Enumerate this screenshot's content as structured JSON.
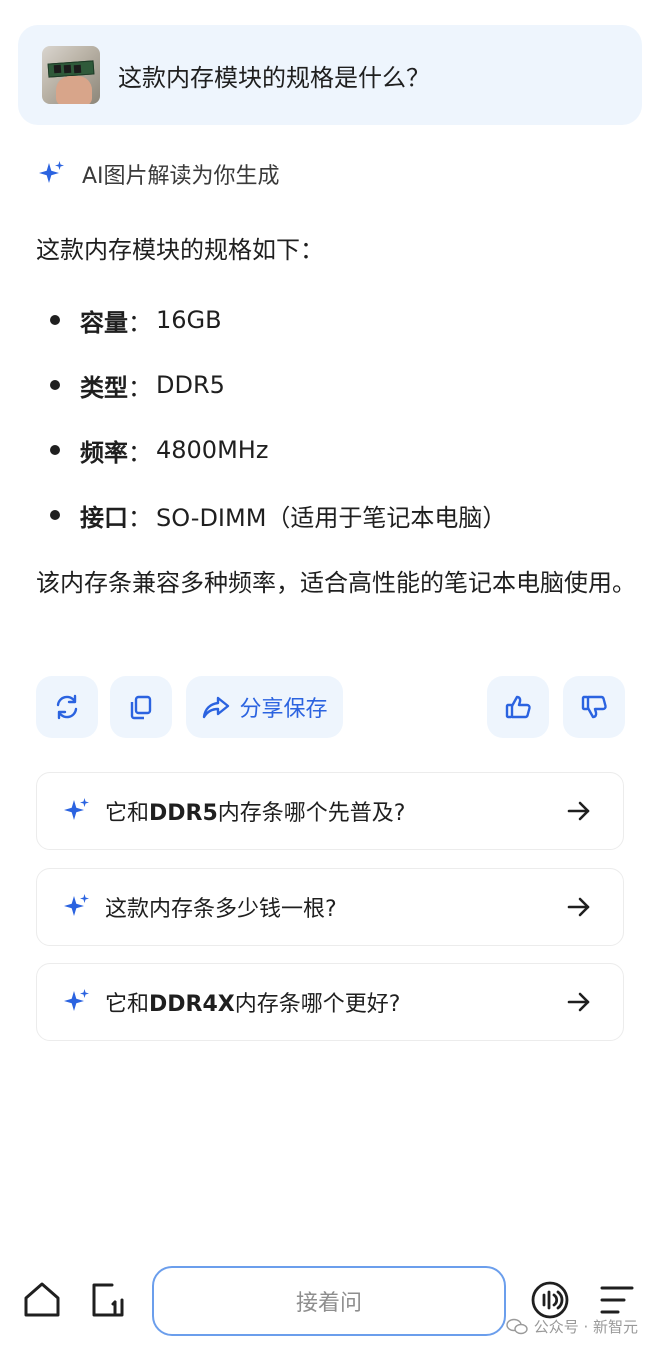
{
  "question": {
    "text": "这款内存模块的规格是什么？"
  },
  "answer": {
    "ai_label": "AI图片解读为你生成",
    "intro": "这款内存模块的规格如下：",
    "specs": [
      {
        "key": "容量",
        "colon": "：",
        "value": "16GB"
      },
      {
        "key": "类型",
        "colon": "：",
        "value": "DDR5"
      },
      {
        "key": "频率",
        "colon": "：",
        "value": "4800MHz"
      },
      {
        "key": "接口",
        "colon": "：",
        "value": "SO-DIMM（适用于笔记本电脑）"
      }
    ],
    "outro": "该内存条兼容多种频率，适合高性能的笔记本电脑使用。"
  },
  "actions": {
    "share_label": "分享保存"
  },
  "suggestions": [
    {
      "parts": [
        {
          "text": "它和"
        },
        {
          "text": "DDR5",
          "bold": true
        },
        {
          "text": "内存条哪个先普及?"
        }
      ]
    },
    {
      "parts": [
        {
          "text": "这款内存条多少钱一根?"
        }
      ]
    },
    {
      "parts": [
        {
          "text": "它和"
        },
        {
          "text": "DDR4X",
          "bold": true
        },
        {
          "text": "内存条哪个更好?"
        }
      ]
    }
  ],
  "bottom_bar": {
    "ask_placeholder": "接着问"
  },
  "watermark": {
    "text": "公众号 · 新智元"
  },
  "colors": {
    "accent": "#2b63e0",
    "bubble_bg": "#eef5fd",
    "input_border": "#6b9eec"
  },
  "icons": [
    "thumbnail-image",
    "sparkle-icon",
    "refresh-icon",
    "copy-icon",
    "share-icon",
    "thumbs-up-icon",
    "thumbs-down-icon",
    "arrow-right-icon",
    "home-icon",
    "new-chat-icon",
    "voice-icon",
    "menu-icon",
    "wechat-icon"
  ]
}
